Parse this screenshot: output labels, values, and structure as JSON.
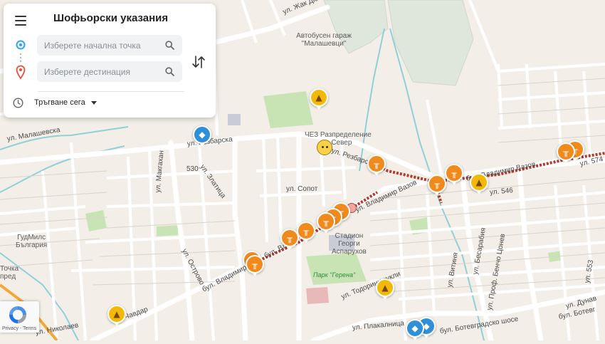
{
  "panel": {
    "title": "Шофьорски указания",
    "origin_placeholder": "Изберете начална точка",
    "destination_placeholder": "Изберете дестинация",
    "departure_label": "Тръгване сега"
  },
  "map": {
    "places": {
      "bus_garage": "Автобусен гараж \"Малашевци\"",
      "chez_1": "ЧЕЗ Разпределение",
      "chez_2": "Север",
      "stadium_1": "Стадион",
      "stadium_2": "Георги",
      "stadium_3": "Аспарухов",
      "gudmils_1": "ГудМилс",
      "gudmils_2": "България",
      "tochka_1": "Точка",
      "tochka_2": "пред",
      "park": "Парк \"Герена\""
    },
    "streets": {
      "zhak_duklo": "ул. Жак Дюкло",
      "rezbarska_1": "ул. Резбарска",
      "rezbarska_2": "ул. Резбарска",
      "malashevska": "ул. Малашевска",
      "zlatitsa": "ул. Златица",
      "makgahan": "ул. Макгахан",
      "r530": "530",
      "sopot": "ул. Сопот",
      "vladimir_vazov_1": "ул. Владимир Вазов",
      "vladimir_vazov_2": "бул. Владимир Вазов",
      "vladimir_vazov_3": "бул. Вл",
      "vladimir_vazov_4": "бул. Владимир",
      "r546": "ул. 546",
      "r574": "ул. 574",
      "ostrovo": "ул. Острово",
      "todorini_kukli": "ул. Тодорини кукли",
      "plakalnitsa": "ул. Плакалница",
      "botevgradsko": "бул. Ботевградско шосе",
      "botevgradsko_2": "бул. Ботевг",
      "vitinya": "ул. Витиня",
      "bensa": "ул. Бесарабия",
      "beno_tsonev": "ул. Проф. Бенчо Цонев",
      "r553": "ул. 553",
      "dunav": "ул. Дунав",
      "chavdar": "ул. Чавдар",
      "nikolaev": "ул. Николаев",
      "dbr": "бул. Д"
    }
  },
  "markers": {
    "construction": "construction-icon",
    "hazard": "hazard-icon",
    "police": "police-icon"
  },
  "recaptcha": {
    "links": "Privacy - Terms"
  },
  "colors": {
    "map_background": "#f3efe8",
    "construction": "#f08a1c",
    "hazard": "#f3b90a",
    "police": "#2f8fd8",
    "closure": "#c0392b"
  }
}
